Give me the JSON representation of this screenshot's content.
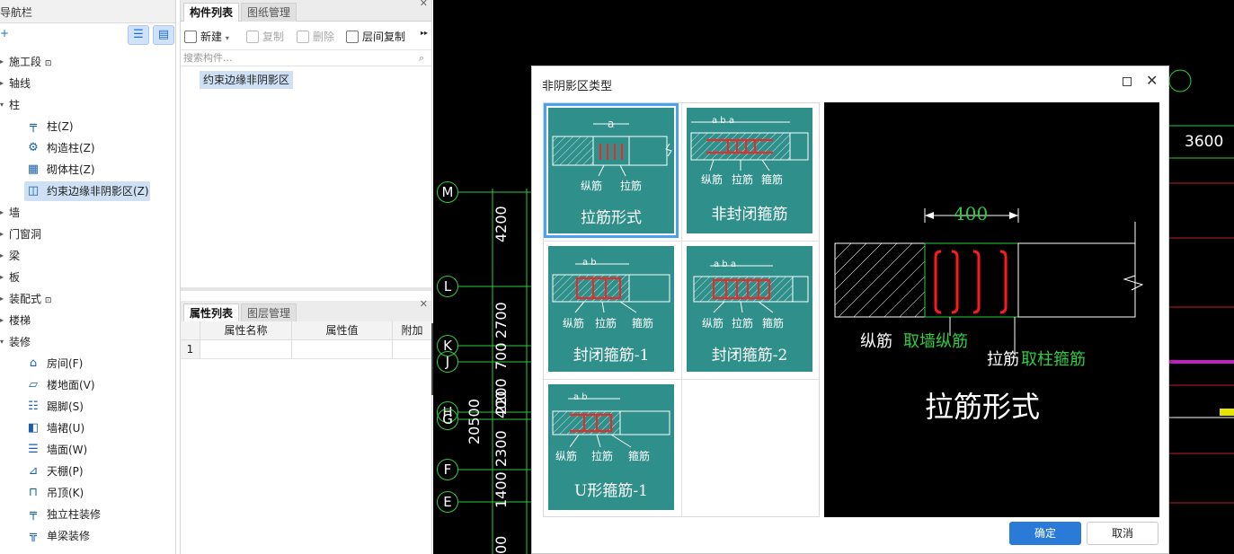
{
  "nav": {
    "title": "导航栏",
    "plus": "+",
    "view_list_icon": "☰",
    "view_detail_icon": "▤",
    "items": [
      {
        "label": "施工段",
        "lock": "🔒"
      },
      {
        "label": "轴线"
      },
      {
        "label": "柱"
      },
      {
        "label": "柱(Z)"
      },
      {
        "label": "构造柱(Z)"
      },
      {
        "label": "砌体柱(Z)"
      },
      {
        "label": "约束边缘非阴影区(Z)"
      },
      {
        "label": "墙"
      },
      {
        "label": "门窗洞"
      },
      {
        "label": "梁"
      },
      {
        "label": "板"
      },
      {
        "label": "装配式",
        "lock": "🔒"
      },
      {
        "label": "楼梯"
      },
      {
        "label": "装修"
      },
      {
        "label": "房间(F)"
      },
      {
        "label": "楼地面(V)"
      },
      {
        "label": "踢脚(S)"
      },
      {
        "label": "墙裙(U)"
      },
      {
        "label": "墙面(W)"
      },
      {
        "label": "天棚(P)"
      },
      {
        "label": "吊顶(K)"
      },
      {
        "label": "独立柱装修"
      },
      {
        "label": "单梁装修"
      }
    ]
  },
  "components": {
    "tabs": [
      "构件列表",
      "图纸管理"
    ],
    "toolbar": {
      "new": "新建",
      "copy": "复制",
      "delete": "删除",
      "floor_copy": "层间复制",
      "more": "▸▸"
    },
    "search_placeholder": "搜索构件...",
    "items": [
      "约束边缘非阴影区"
    ]
  },
  "properties": {
    "tabs": [
      "属性列表",
      "图层管理"
    ],
    "columns": [
      "属性名称",
      "属性值",
      "附加"
    ],
    "rows": [
      "1"
    ]
  },
  "cad": {
    "axes": [
      "M",
      "L",
      "K",
      "J",
      "H",
      "G",
      "F",
      "E"
    ],
    "dims": [
      "4200",
      "2700",
      "700",
      "2200",
      "2300",
      "400",
      "1400",
      "20500",
      "00"
    ],
    "right_dim": "3600"
  },
  "dialog": {
    "title": "非阴影区类型",
    "max_icon": "□",
    "close_icon": "✕",
    "cards": [
      {
        "label": "拉筋形式",
        "sub": [
          "纵筋",
          "拉筋"
        ],
        "dims": "a"
      },
      {
        "label": "非封闭箍筋",
        "sub": [
          "纵筋",
          "拉筋",
          "箍筋"
        ],
        "dims": "a b a"
      },
      {
        "label": "封闭箍筋-1",
        "sub": [
          "纵筋",
          "拉筋",
          "箍筋"
        ],
        "dims": "a b"
      },
      {
        "label": "封闭箍筋-2",
        "sub": [
          "纵筋",
          "拉筋",
          "箍筋"
        ],
        "dims": "a b a"
      },
      {
        "label": "U形箍筋-1",
        "sub": [
          "纵筋",
          "拉筋",
          "箍筋"
        ],
        "dims": "a b"
      }
    ],
    "preview": {
      "dim": "400",
      "label1_a": "纵筋",
      "label1_b": "取墙纵筋",
      "label2_a": "拉筋",
      "label2_b": "取柱箍筋",
      "caption": "拉筋形式",
      "green": "#2ecc40",
      "red": "#ff1a1a"
    },
    "ok": "确定",
    "cancel": "取消"
  }
}
